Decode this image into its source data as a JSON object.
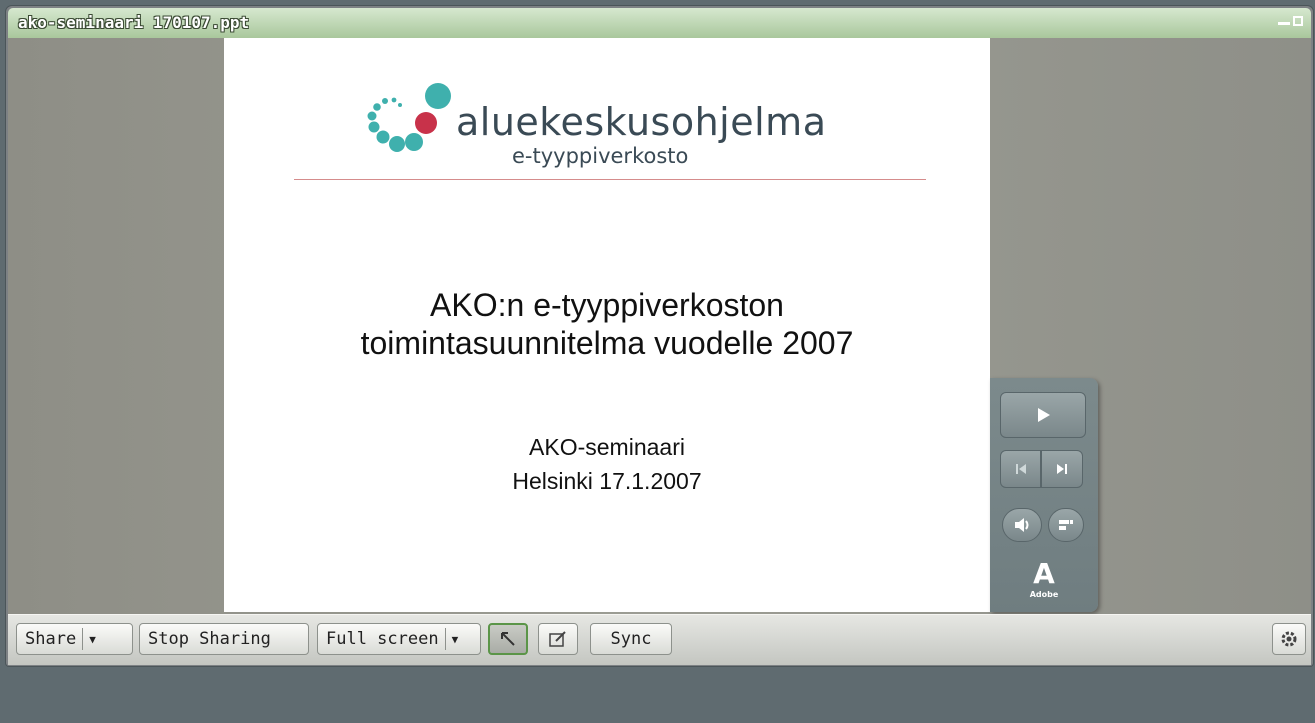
{
  "window": {
    "title": "ako-seminaari 170107.ppt"
  },
  "slide": {
    "logo_word": "aluekeskusohjelma",
    "logo_sub": "e-tyyppiverkosto",
    "title_line1": "AKO:n e-tyyppiverkoston",
    "title_line2": "toimintasuunnitelma vuodelle 2007",
    "sub_line1": "AKO-seminaari",
    "sub_line2": "Helsinki 17.1.2007"
  },
  "controls": {
    "play_icon": "play-icon",
    "prev_icon": "previous-slide-icon",
    "next_icon": "next-slide-icon",
    "volume_icon": "volume-icon",
    "captions_icon": "captions-icon",
    "brand_text": "Adobe"
  },
  "toolbar": {
    "share_label": "Share",
    "stop_sharing_label": "Stop Sharing",
    "full_screen_label": "Full screen",
    "sync_label": "Sync"
  },
  "colors": {
    "title_bar": "#bcd6b0",
    "logo_teal": "#3fb0ad",
    "logo_red": "#c8324a",
    "slide_rule": "#d58c8c",
    "active_tool_border": "#5b9548"
  }
}
